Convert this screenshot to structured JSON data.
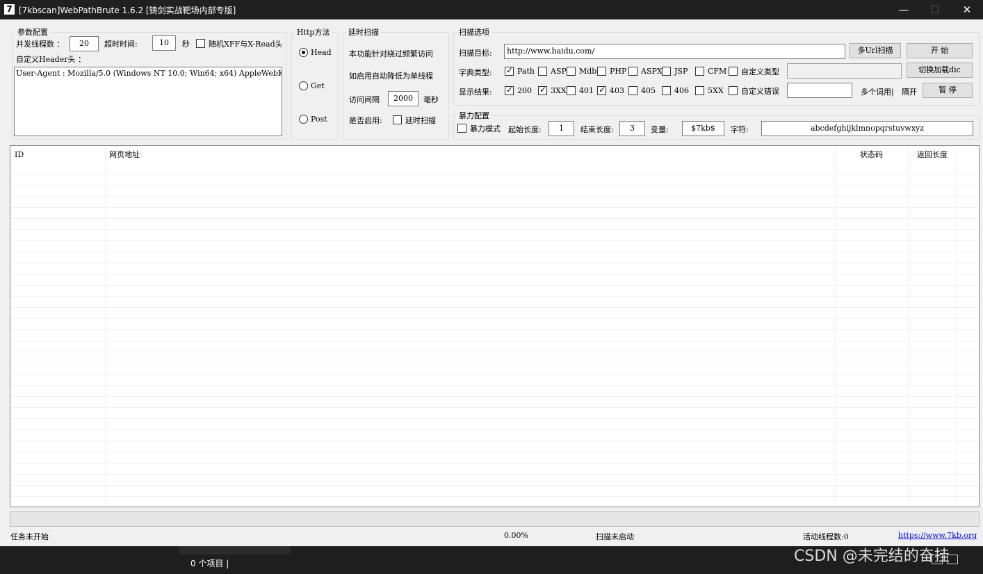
{
  "window": {
    "title": "[7kbscan]WebPathBrute 1.6.2 [铸剑实战靶场内部专版]",
    "app_icon_glyph": "7",
    "minimize_glyph": "—",
    "maximize_glyph": "☐",
    "close_glyph": "✕"
  },
  "params": {
    "legend": "参数配置",
    "threads_label": "并发线程数 ：",
    "threads_value": "20",
    "timeout_label": "超时时间:",
    "timeout_value": "10",
    "timeout_unit": "秒",
    "random_xff_label": "随机XFF与X-Read头",
    "random_xff_checked": false,
    "custom_header_label": "自定义Header头 ：",
    "header_value": "User-Agent : Mozilla/5.0 (Windows NT 10.0; Win64; x64) AppleWebK"
  },
  "http_method": {
    "legend": "Http方法",
    "options": [
      "Head",
      "Get",
      "Post"
    ],
    "selected": "Head"
  },
  "delay_scan": {
    "legend": "延时扫描",
    "desc_line1": "本功能针对绕过频繁访问",
    "desc_line2": "如启用自动降低为单线程",
    "interval_label": "访问间隔",
    "interval_value": "2000",
    "interval_unit": "毫秒",
    "enable_label": "是否启用:",
    "enable_checkbox_label": "延时扫描",
    "enabled": false
  },
  "scan_options": {
    "legend": "扫描选项",
    "target_label": "扫描目标:",
    "target_value": "http://www.baidu.com/",
    "multi_url_button": "多Url扫描",
    "start_button": "开 始",
    "dict_label": "字典类型:",
    "dict_types": [
      {
        "label": "Path",
        "checked": true
      },
      {
        "label": "ASP",
        "checked": false
      },
      {
        "label": "Mdb",
        "checked": false
      },
      {
        "label": "PHP",
        "checked": false
      },
      {
        "label": "ASPX",
        "checked": false
      },
      {
        "label": "JSP",
        "checked": false
      },
      {
        "label": "CFM",
        "checked": false
      },
      {
        "label": "自定义类型",
        "checked": false
      }
    ],
    "custom_type_value": "",
    "switch_dic_button": "切换加载dic",
    "result_label": "显示结果:",
    "result_codes": [
      {
        "label": "200",
        "checked": true
      },
      {
        "label": "3XX",
        "checked": true
      },
      {
        "label": "401",
        "checked": false
      },
      {
        "label": "403",
        "checked": true
      },
      {
        "label": "405",
        "checked": false
      },
      {
        "label": "406",
        "checked": false
      },
      {
        "label": "5XX",
        "checked": false
      },
      {
        "label": "自定义错误",
        "checked": false
      }
    ],
    "custom_error_value": "",
    "multi_word_label": "多个词用|",
    "separate_label": "隔开",
    "pause_button": "暂 停"
  },
  "brute": {
    "legend": "暴力配置",
    "mode_label": "暴力模式",
    "mode_checked": false,
    "start_len_label": "起始长度:",
    "start_len_value": "1",
    "end_len_label": "结束长度:",
    "end_len_value": "3",
    "var_label": "变量:",
    "var_value": "$7kb$",
    "chars_label": "字符:",
    "chars_value": "abcdefghijklmnopqrstuvwxyz"
  },
  "results_table": {
    "columns": [
      "ID",
      "网页地址",
      "状态码",
      "返回长度"
    ],
    "rows": []
  },
  "progress": {
    "percent": 0
  },
  "status": {
    "task": "任务未开始",
    "percent": "0.00%",
    "scan": "扫描未启动",
    "active_threads": "活动线程数:0",
    "link": "https://www.7kb.org"
  },
  "taskbar": {
    "items_count": "0 个项目  |",
    "watermark": "CSDN @未完结的奋挂"
  }
}
